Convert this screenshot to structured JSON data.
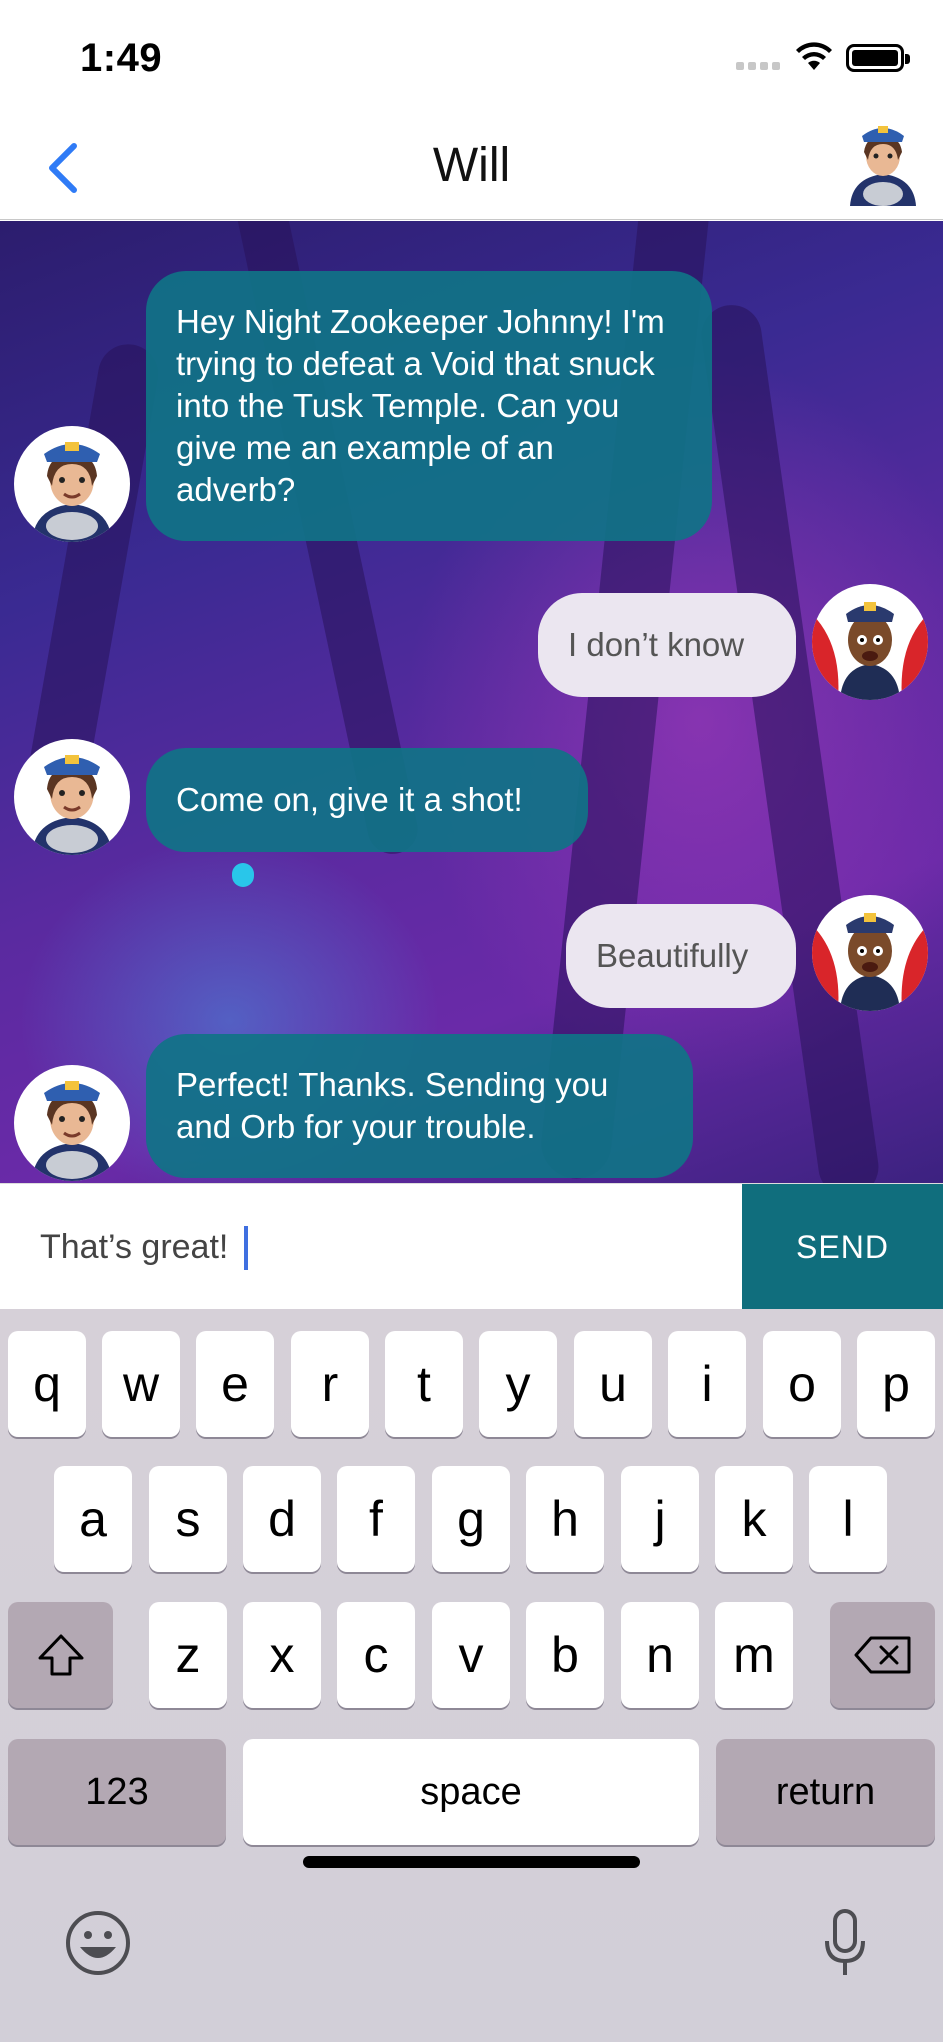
{
  "status_bar": {
    "time": "1:49"
  },
  "nav": {
    "title": "Will"
  },
  "messages": [
    {
      "sender": "npc",
      "text": "Hey Night Zookeeper Johnny! I'm trying to defeat a Void that snuck into the Tusk Temple. Can you give me an example of an adverb?"
    },
    {
      "sender": "user",
      "text": "I don’t know"
    },
    {
      "sender": "npc",
      "text": "Come on, give it a shot!"
    },
    {
      "sender": "user",
      "text": "Beautifully"
    },
    {
      "sender": "npc",
      "text": "Perfect! Thanks. Sending you and Orb for your trouble."
    }
  ],
  "composer": {
    "value": "That’s great!",
    "send_label": "SEND"
  },
  "keyboard": {
    "row1": [
      "q",
      "w",
      "e",
      "r",
      "t",
      "y",
      "u",
      "i",
      "o",
      "p"
    ],
    "row2": [
      "a",
      "s",
      "d",
      "f",
      "g",
      "h",
      "j",
      "k",
      "l"
    ],
    "row3": [
      "z",
      "x",
      "c",
      "v",
      "b",
      "n",
      "m"
    ],
    "numbers_label": "123",
    "space_label": "space",
    "return_label": "return"
  },
  "colors": {
    "npc_bubble": "#106e7d",
    "user_bubble": "#ebe6f0",
    "send_button": "#106e7d",
    "back_chevron": "#2f7bf6"
  },
  "icons": [
    "back-chevron-icon",
    "wifi-icon",
    "battery-icon",
    "shift-icon",
    "delete-icon",
    "emoji-icon",
    "microphone-icon"
  ]
}
